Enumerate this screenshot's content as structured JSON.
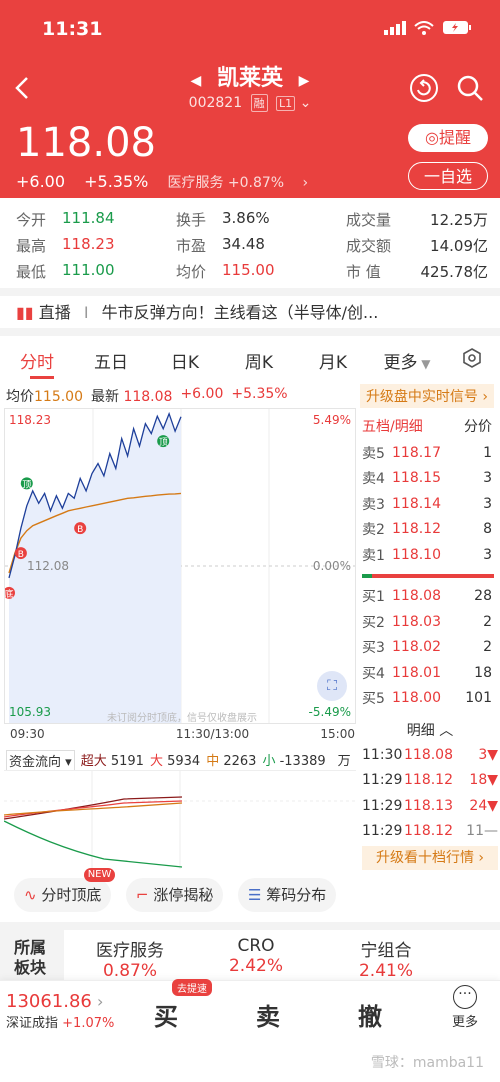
{
  "status": {
    "time": "11:31"
  },
  "header": {
    "stock_name": "凯莱英",
    "stock_code": "002821",
    "tag_rong": "融",
    "tag_level": "L1",
    "price": "118.08",
    "change": "+6.00",
    "change_pct": "+5.35%",
    "sector": "医疗服务 +0.87%",
    "remind_label": "提醒",
    "watchlist_label": "一自选"
  },
  "stats": [
    {
      "l1": "今开",
      "v1": "111.84",
      "l2": "换手",
      "v2": "3.86%",
      "l3": "成交量",
      "v3": "12.25万"
    },
    {
      "l1": "最高",
      "v1": "118.23",
      "l2": "市盈",
      "v2": "34.48",
      "l3": "成交额",
      "v3": "14.09亿"
    },
    {
      "l1": "最低",
      "v1": "111.00",
      "l2": "均价",
      "v2": "115.00",
      "l3": "市 值",
      "v3": "425.78亿"
    }
  ],
  "news": {
    "tag": "直播",
    "sep": "I",
    "text": "牛市反弹方向！主线看这（半导体/创..."
  },
  "tabs": [
    "分时",
    "五日",
    "日K",
    "周K",
    "月K",
    "更多"
  ],
  "intraday": {
    "avg_label": "均价",
    "avg_value": "115.00",
    "latest_label": "最新",
    "latest_value": "118.08",
    "chg": "+6.00",
    "chg_pct": "+5.35%",
    "upgrade_label": "升级盘中实时信号"
  },
  "chart_data": {
    "type": "line",
    "title": "",
    "ylim": [
      105.93,
      118.23
    ],
    "y_top_label": "118.23",
    "y_mid_label": "112.08",
    "y_bottom_label": "105.93",
    "pct_top": "5.49%",
    "pct_mid": "0.00%",
    "pct_bottom": "-5.49%",
    "x_labels": [
      "09:30",
      "11:30/13:00",
      "15:00"
    ],
    "watermark": "未订阅分时顶底，信号仅收盘展示",
    "signal_top": "顶",
    "signal_buy": "B",
    "signal_bottom": "底",
    "series": [
      {
        "values": [
          111.6,
          112.5,
          113.6,
          114.5,
          115.1,
          114.6,
          115.0,
          114.3,
          114.9,
          114.4,
          115.0,
          114.8,
          115.6,
          115.1,
          115.8,
          116.2,
          115.7,
          116.6,
          116.0,
          117.2,
          116.5,
          117.6,
          116.9,
          117.8,
          117.4,
          118.1,
          117.6,
          118.2,
          117.5,
          118.08
        ]
      },
      {
        "values": [
          111.8,
          112.6,
          113.2,
          113.5,
          113.7,
          113.8,
          113.9,
          114.0,
          114.1,
          114.2,
          114.3,
          114.35,
          114.4,
          114.45,
          114.5,
          114.55,
          114.6,
          114.65,
          114.7,
          114.75,
          114.8,
          114.82,
          114.85,
          114.88,
          114.9,
          114.93,
          114.95,
          114.97,
          114.98,
          115.0
        ]
      }
    ]
  },
  "order_book": {
    "header_left": "五档/明细",
    "header_right": "分价",
    "asks": [
      {
        "n": "卖5",
        "p": "118.17",
        "q": "1"
      },
      {
        "n": "卖4",
        "p": "118.15",
        "q": "3"
      },
      {
        "n": "卖3",
        "p": "118.14",
        "q": "3"
      },
      {
        "n": "卖2",
        "p": "118.12",
        "q": "8"
      },
      {
        "n": "卖1",
        "p": "118.10",
        "q": "3"
      }
    ],
    "bids": [
      {
        "n": "买1",
        "p": "118.08",
        "q": "28"
      },
      {
        "n": "买2",
        "p": "118.03",
        "q": "2"
      },
      {
        "n": "买3",
        "p": "118.02",
        "q": "2"
      },
      {
        "n": "买4",
        "p": "118.01",
        "q": "18"
      },
      {
        "n": "买5",
        "p": "118.00",
        "q": "101"
      }
    ],
    "detail_label": "明细",
    "ticks": [
      {
        "t": "11:30",
        "p": "118.08",
        "q": "3"
      },
      {
        "t": "11:29",
        "p": "118.12",
        "q": "18"
      },
      {
        "t": "11:29",
        "p": "118.13",
        "q": "24"
      },
      {
        "t": "11:29",
        "p": "118.12",
        "q": "11"
      }
    ],
    "upgrade_ten": "升级看十档行情"
  },
  "fund_flow": {
    "label": "资金流向",
    "super_label": "超大",
    "super": "5191",
    "big_label": "大",
    "big": "5934",
    "mid_label": "中",
    "mid": "2263",
    "small_label": "小",
    "small": "-13389",
    "unit": "万"
  },
  "features": {
    "f1": "分时顶底",
    "f1_badge": "NEW",
    "f2": "涨停揭秘",
    "f3": "筹码分布"
  },
  "sectors": {
    "label1": "所属",
    "label2": "板块",
    "items": [
      {
        "name": "医疗服务",
        "chg": "0.87%"
      },
      {
        "name": "CRO",
        "chg": "2.42%"
      },
      {
        "name": "宁组合",
        "chg": "2.41%"
      }
    ]
  },
  "bottom_bar": {
    "index_value": "13061.86",
    "index_name": "深证成指",
    "index_chg": "+1.07%",
    "buy": "买",
    "buy_badge": "去提速",
    "sell": "卖",
    "cancel": "撤",
    "more": "更多"
  },
  "watermark": "雪球：mamba11"
}
